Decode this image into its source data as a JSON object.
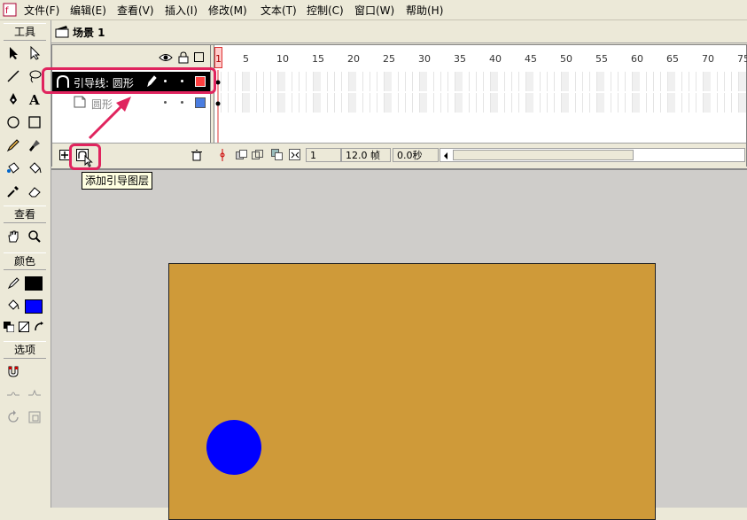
{
  "menu": [
    "文件(F)",
    "编辑(E)",
    "查看(V)",
    "插入(I)",
    "修改(M)",
    "文本(T)",
    "控制(C)",
    "窗口(W)",
    "帮助(H)"
  ],
  "tools": {
    "title": "工具",
    "view_title": "查看",
    "color_title": "颜色",
    "options_title": "选项",
    "stroke_color": "#000000",
    "fill_color": "#0000ff"
  },
  "scene": {
    "title": "场景 1"
  },
  "timeline": {
    "ruler_ticks": [
      "1",
      "5",
      "10",
      "15",
      "20",
      "25",
      "30",
      "35",
      "40",
      "45",
      "50",
      "55",
      "60",
      "65",
      "70",
      "75"
    ],
    "layers": [
      {
        "name": "引导线: 圆形",
        "selected": true,
        "color": "#ff4040"
      },
      {
        "name": "圆形",
        "selected": false,
        "color": "#4a7de0"
      }
    ],
    "current_frame": "1",
    "frame_rate": "12.0 帧",
    "elapsed": "0.0秒"
  },
  "tooltip": "添加引导图层",
  "stage": {
    "background": "#cf9a39",
    "circle_color": "#0000ff"
  },
  "annotation_color": "#e0245e"
}
